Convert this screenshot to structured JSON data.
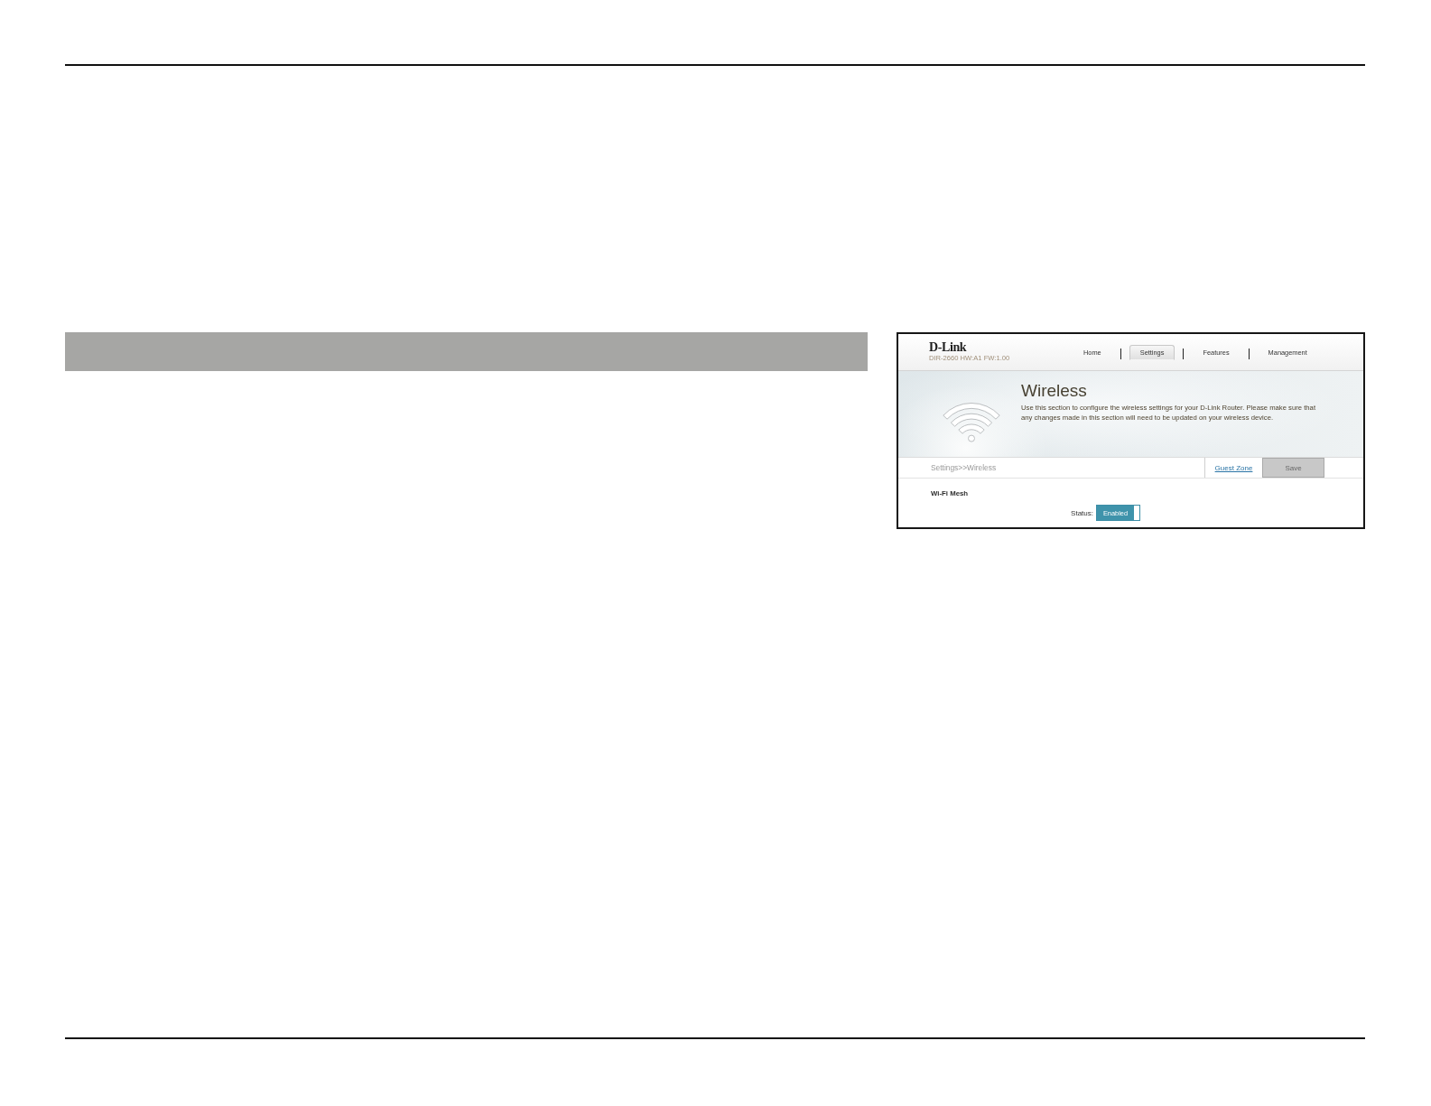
{
  "screenshot": {
    "brand": {
      "logo": "D-Link",
      "model": "DIR-2660 HW:A1 FW:1.00"
    },
    "nav": [
      {
        "label": "Home",
        "selected": false
      },
      {
        "label": "Settings",
        "selected": true
      },
      {
        "label": "Features",
        "selected": false
      },
      {
        "label": "Management",
        "selected": false
      }
    ],
    "banner": {
      "title": "Wireless",
      "description": "Use this section to configure the wireless settings for your D-Link Router. Please make sure that any changes made in this section will need to be updated on your wireless device."
    },
    "breadcrumb": "Settings>>Wireless",
    "actions": [
      {
        "kind": "link",
        "label": "Guest Zone"
      },
      {
        "kind": "button",
        "label": "Save",
        "disabled": true
      }
    ],
    "section": {
      "title": "Wi-Fi Mesh",
      "fields": [
        {
          "kind": "toggle",
          "label": "Status:",
          "value": "Enabled",
          "on": true
        }
      ]
    }
  }
}
